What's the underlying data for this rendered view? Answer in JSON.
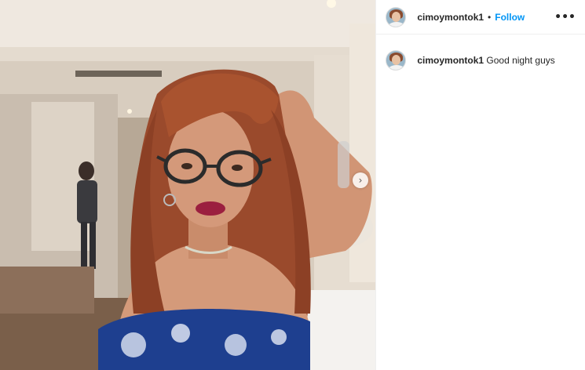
{
  "post": {
    "image_alt": "Selfie of a woman with auburn hair and round glasses in a room",
    "next_icon": "chevron-right-icon",
    "next_glyph": "›"
  },
  "header": {
    "username": "cimoymontok1",
    "separator": "•",
    "follow_label": "Follow",
    "more_glyph": "•••"
  },
  "caption": {
    "username": "cimoymontok1",
    "text": "Good night guys"
  },
  "colors": {
    "follow_blue": "#0095f6",
    "text_dark": "#262626",
    "divider": "#efefef"
  }
}
